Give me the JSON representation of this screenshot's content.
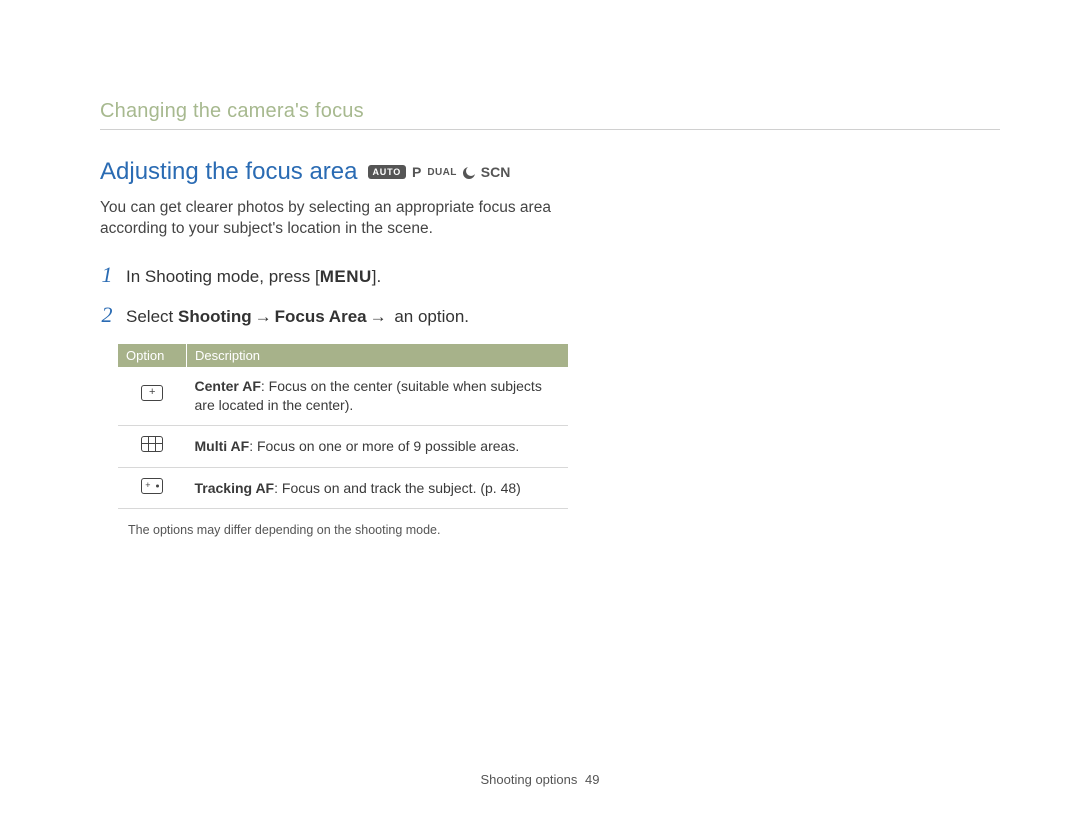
{
  "section_header": "Changing the camera's focus",
  "title": "Adjusting the focus area",
  "mode_badges": {
    "auto": "AUTO",
    "p": "P",
    "dual": "DUAL",
    "scn": "SCN"
  },
  "intro": "You can get clearer photos by selecting an appropriate focus area according to your subject's location in the scene.",
  "steps": [
    {
      "prefix": "In Shooting mode, press [",
      "key": "MENU",
      "suffix": "]."
    },
    {
      "prefix": "Select ",
      "b1": "Shooting",
      "arrow": " → ",
      "b2": "Focus Area",
      "suffix": " an option."
    }
  ],
  "table": {
    "head": {
      "option": "Option",
      "description": "Description"
    },
    "rows": [
      {
        "icon": "center",
        "name": "Center AF",
        "text": ": Focus on the center (suitable when subjects are located in the center)."
      },
      {
        "icon": "multi",
        "name": "Multi AF",
        "text": ": Focus on one or more of 9 possible areas."
      },
      {
        "icon": "tracking",
        "name": "Tracking AF",
        "text": ": Focus on and track the subject. (p. 48)"
      }
    ]
  },
  "note": "The options may differ depending on the shooting mode.",
  "footer": {
    "label": "Shooting options",
    "page_number": "49"
  }
}
